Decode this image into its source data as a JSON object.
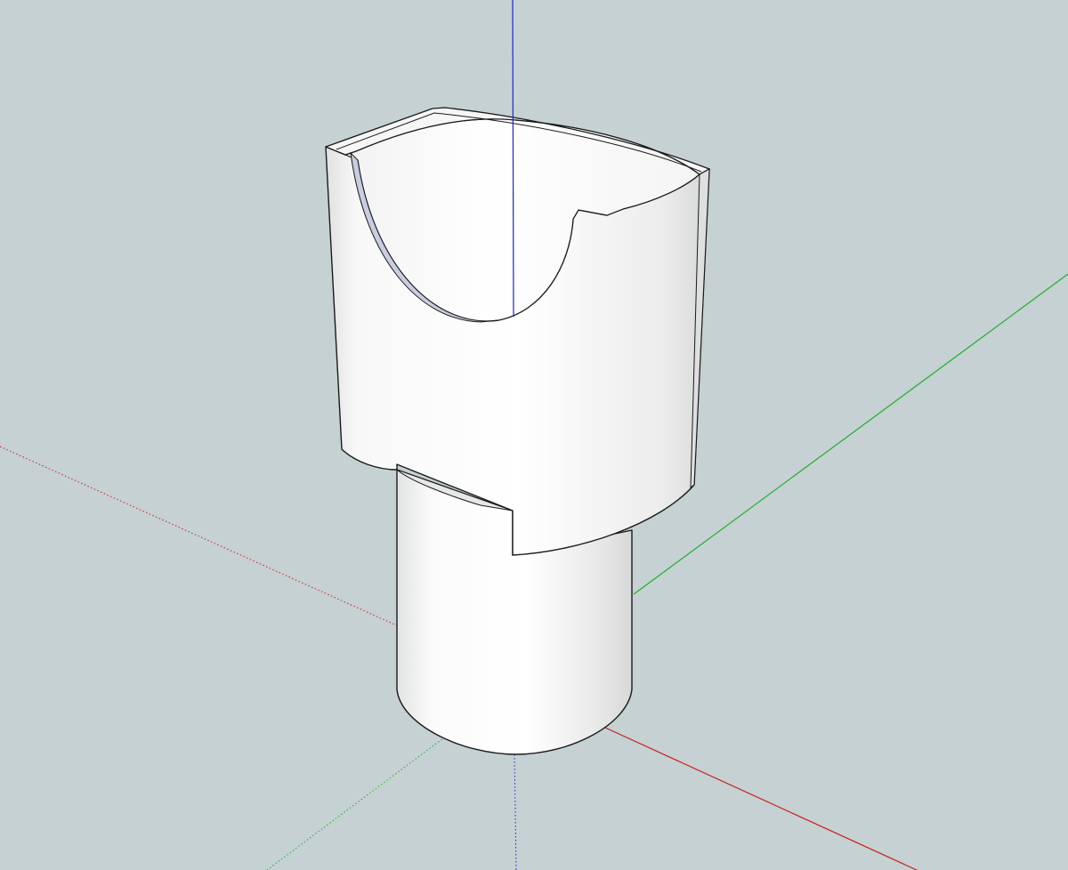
{
  "viewport": {
    "background": "#c5d1d3",
    "axes": {
      "red_axis_color": "#c8201e",
      "green_axis_color": "#1fae2a",
      "blue_axis_color": "#1a28c8"
    },
    "model": {
      "face_color": "#ffffff",
      "edge_color": "#1a1a1a",
      "inner_wall_color": "#c9cde0"
    }
  }
}
